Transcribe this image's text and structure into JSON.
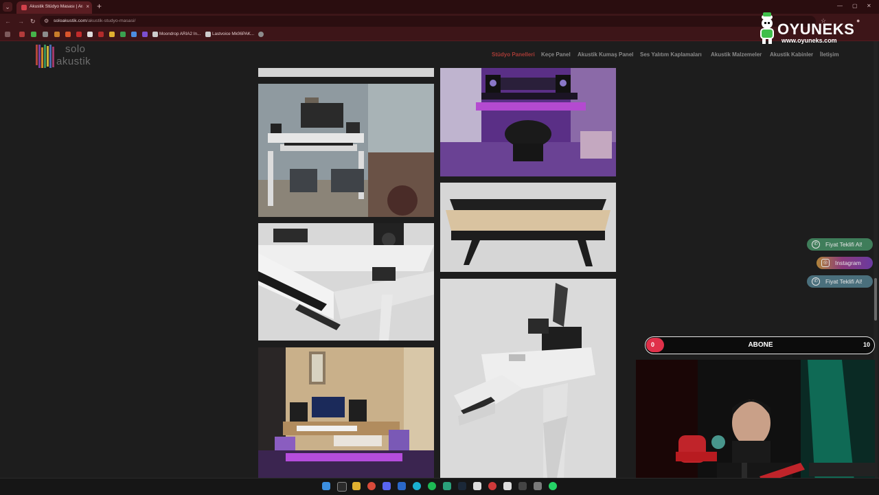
{
  "browser": {
    "tab_title": "Akustik Stüdyo Masası | Aranjö",
    "tab_close": "×",
    "new_tab": "+",
    "url_domain": "soloakustik.com",
    "url_path": "/akustik-studyo-masasi/",
    "bookmarks": [
      "Moondrop ARIA2 In...",
      "Lastvoice Mk06PAK..."
    ]
  },
  "site": {
    "logo_line1": "solo",
    "logo_line2": "akustik",
    "nav": [
      "Stüdyo Panelleri",
      "Keçe Panel",
      "Akustik Kumaş Panel",
      "Ses Yalıtım Kaplamaları",
      "Akustik Malzemeler",
      "Akustik Kabinler",
      "İletişim"
    ],
    "fabs": {
      "whatsapp": "Fiyat Teklifi Al!",
      "instagram": "Instagram",
      "phone": "Fiyat Teklifi Al!"
    }
  },
  "overlay": {
    "brand_name": "OYUNEKS",
    "brand_url": "www.oyuneks.com",
    "sub_current": "0",
    "sub_label": "ABONE",
    "sub_goal": "10"
  },
  "colors": {
    "browser_accent": "#5a1d22",
    "nav_active": "#a63b36",
    "sub_bar": "#e0314a",
    "whatsapp": "#3f7d5a",
    "instagram": "#8a3a7a"
  }
}
